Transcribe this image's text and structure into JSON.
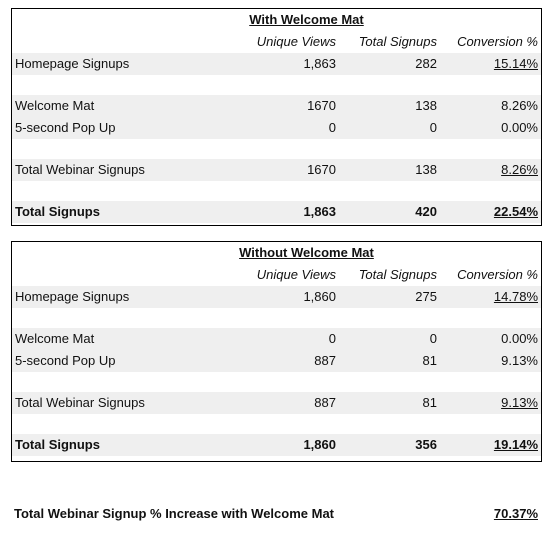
{
  "table1": {
    "title": "With Welcome Mat",
    "headers": [
      "Unique Views",
      "Total Signups",
      "Conversion %"
    ],
    "rows": [
      {
        "label": "Homepage Signups",
        "unique_views": "1,863",
        "total_signups": "282",
        "conversion": "15.14%"
      },
      {
        "label": "Welcome Mat",
        "unique_views": "1670",
        "total_signups": "138",
        "conversion": "8.26%"
      },
      {
        "label": "5-second Pop Up",
        "unique_views": "0",
        "total_signups": "0",
        "conversion": "0.00%"
      },
      {
        "label": "Total Webinar Signups",
        "unique_views": "1670",
        "total_signups": "138",
        "conversion": "8.26%"
      },
      {
        "label": "Total Signups",
        "unique_views": "1,863",
        "total_signups": "420",
        "conversion": "22.54%"
      }
    ]
  },
  "table2": {
    "title": "Without Welcome Mat",
    "headers": [
      "Unique Views",
      "Total Signups",
      "Conversion %"
    ],
    "rows": [
      {
        "label": "Homepage Signups",
        "unique_views": "1,860",
        "total_signups": "275",
        "conversion": "14.78%"
      },
      {
        "label": "Welcome Mat",
        "unique_views": "0",
        "total_signups": "0",
        "conversion": "0.00%"
      },
      {
        "label": "5-second Pop Up",
        "unique_views": "887",
        "total_signups": "81",
        "conversion": "9.13%"
      },
      {
        "label": "Total Webinar Signups",
        "unique_views": "887",
        "total_signups": "81",
        "conversion": "9.13%"
      },
      {
        "label": "Total Signups",
        "unique_views": "1,860",
        "total_signups": "356",
        "conversion": "19.14%"
      }
    ]
  },
  "summary": {
    "label": "Total Webinar Signup % Increase with Welcome Mat",
    "value": "70.37%"
  },
  "colors": {
    "row_shade": "#efefef",
    "border": "#000000"
  }
}
